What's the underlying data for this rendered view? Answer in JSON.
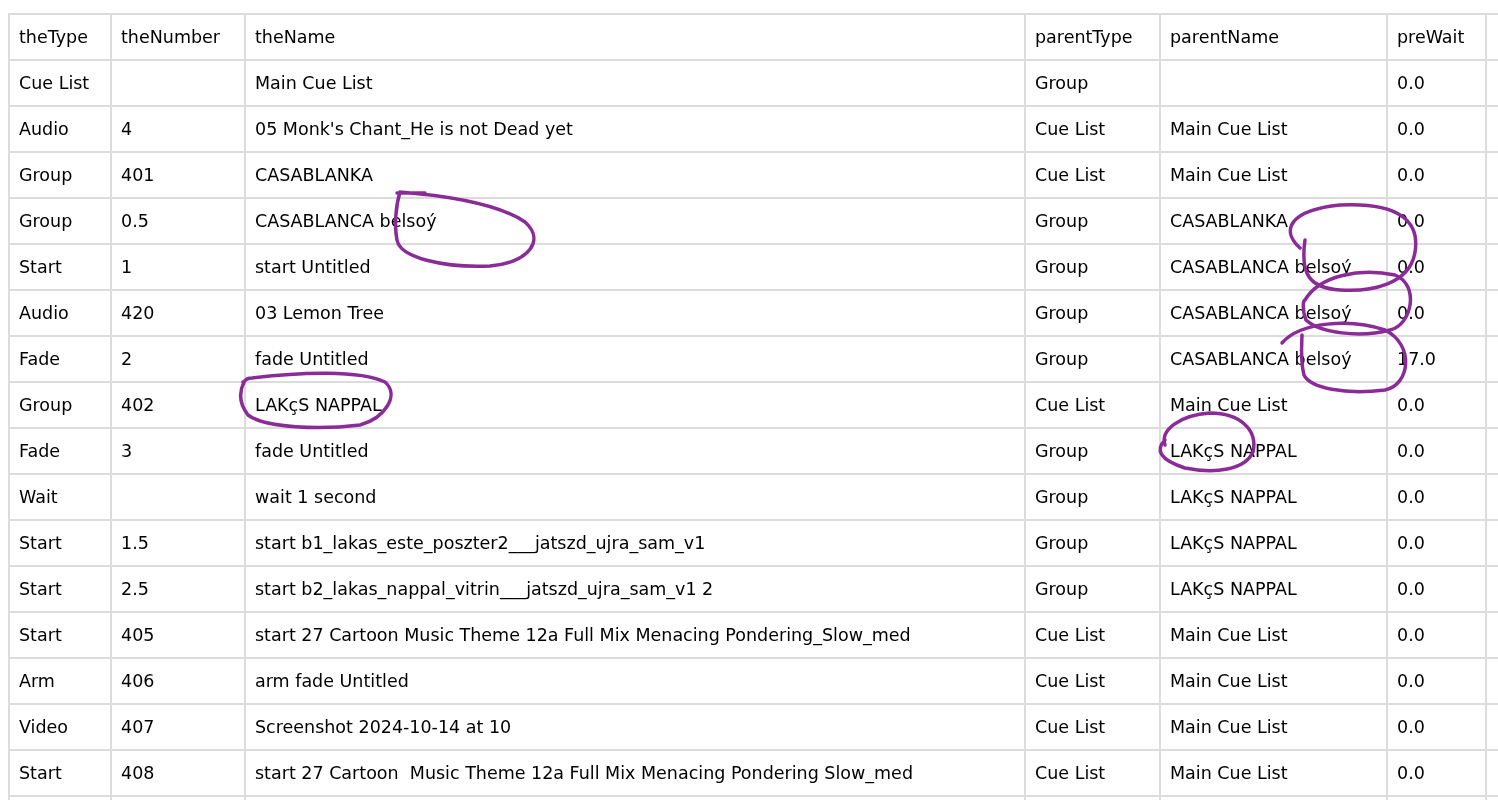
{
  "table": {
    "columns": [
      "theType",
      "theNumber",
      "theName",
      "parentType",
      "parentName",
      "preWait"
    ],
    "rows": [
      [
        "Cue List",
        null,
        "Main Cue List",
        "Group",
        null,
        "0.0"
      ],
      [
        "Audio",
        "4",
        "05 Monk's Chant_He is not Dead yet",
        "Cue List",
        "Main Cue List",
        "0.0"
      ],
      [
        "Group",
        "401",
        "CASABLANKA",
        "Cue List",
        "Main Cue List",
        "0.0"
      ],
      [
        "Group",
        "0.5",
        "CASABLANCA belsoý",
        "Group",
        "CASABLANKA",
        "0.0"
      ],
      [
        "Start",
        "1",
        "start Untitled",
        "Group",
        "CASABLANCA belsoý",
        "0.0"
      ],
      [
        "Audio",
        "420",
        "03 Lemon Tree",
        "Group",
        "CASABLANCA belsoý",
        "0.0"
      ],
      [
        "Fade",
        "2",
        "fade Untitled",
        "Group",
        "CASABLANCA belsoý",
        "17.0"
      ],
      [
        "Group",
        "402",
        "LAKçS NAPPAL",
        "Cue List",
        "Main Cue List",
        "0.0"
      ],
      [
        "Fade",
        "3",
        "fade Untitled",
        "Group",
        "LAKçS NAPPAL",
        "0.0"
      ],
      [
        "Wait",
        null,
        "wait 1 second",
        "Group",
        "LAKçS NAPPAL",
        "0.0"
      ],
      [
        "Start",
        "1.5",
        "start b1_lakas_este_poszter2___jatszd_ujra_sam_v1",
        "Group",
        "LAKçS NAPPAL",
        "0.0"
      ],
      [
        "Start",
        "2.5",
        "start b2_lakas_nappal_vitrin___jatszd_ujra_sam_v1 2",
        "Group",
        "LAKçS NAPPAL",
        "0.0"
      ],
      [
        "Start",
        "405",
        "start 27 Cartoon Music Theme 12a Full Mix Menacing Pondering_Slow_med",
        "Cue List",
        "Main Cue List",
        "0.0"
      ],
      [
        "Arm",
        "406",
        "arm fade Untitled",
        "Cue List",
        "Main Cue List",
        "0.0"
      ],
      [
        "Video",
        "407",
        "Screenshot 2024-10-14 at 10",
        "Cue List",
        "Main Cue List",
        "0.0"
      ],
      [
        "Start",
        "408",
        "start 27 Cartoon  Music Theme 12a Full Mix Menacing Pondering Slow_med",
        "Cue List",
        "Main Cue List",
        "0.0"
      ]
    ]
  }
}
